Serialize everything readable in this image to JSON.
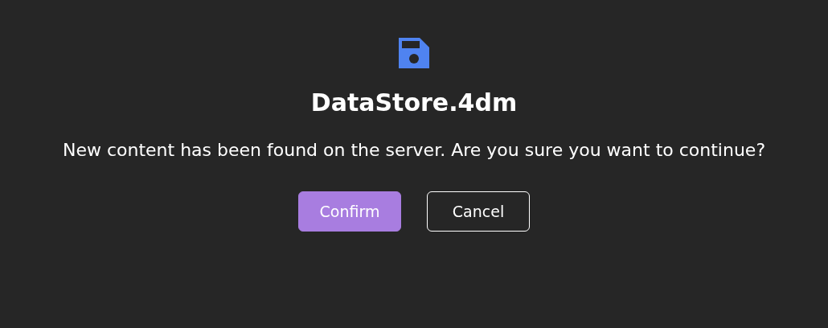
{
  "dialog": {
    "title": "DataStore.4dm",
    "message": "New content has been found on the server. Are you sure you want to continue?",
    "buttons": [
      {
        "label": "Confirm",
        "kind": "primary"
      },
      {
        "label": "Cancel",
        "kind": "secondary"
      }
    ]
  }
}
